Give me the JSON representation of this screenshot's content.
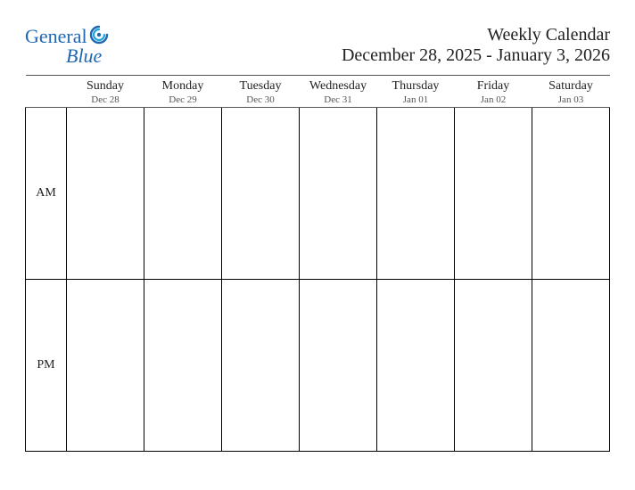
{
  "brand": {
    "line1": "General",
    "line2": "Blue"
  },
  "heading": {
    "title": "Weekly Calendar",
    "range": "December 28, 2025 - January 3, 2026"
  },
  "days": [
    {
      "name": "Sunday",
      "date": "Dec 28"
    },
    {
      "name": "Monday",
      "date": "Dec 29"
    },
    {
      "name": "Tuesday",
      "date": "Dec 30"
    },
    {
      "name": "Wednesday",
      "date": "Dec 31"
    },
    {
      "name": "Thursday",
      "date": "Jan 01"
    },
    {
      "name": "Friday",
      "date": "Jan 02"
    },
    {
      "name": "Saturday",
      "date": "Jan 03"
    }
  ],
  "rows": {
    "am": "AM",
    "pm": "PM"
  }
}
